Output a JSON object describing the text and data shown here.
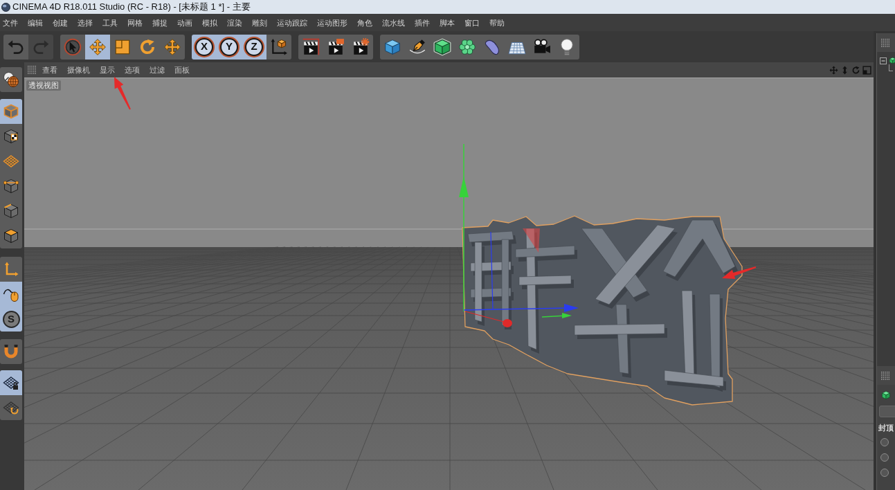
{
  "window": {
    "title": "CINEMA 4D R18.011 Studio (RC - R18) - [未标题 1 *] - 主要"
  },
  "menu": [
    "文件",
    "编辑",
    "创建",
    "选择",
    "工具",
    "网格",
    "捕捉",
    "动画",
    "模拟",
    "渲染",
    "雕刻",
    "运动跟踪",
    "运动图形",
    "角色",
    "流水线",
    "插件",
    "脚本",
    "窗口",
    "帮助"
  ],
  "toolbar": [
    {
      "items": [
        {
          "kind": "undo",
          "selected": false,
          "disabled": false
        },
        {
          "kind": "redo",
          "selected": false,
          "disabled": true
        }
      ]
    },
    {
      "items": [
        {
          "kind": "select",
          "selected": false,
          "disabled": false
        },
        {
          "kind": "move",
          "selected": true,
          "disabled": false
        },
        {
          "kind": "scale",
          "selected": false,
          "disabled": false
        },
        {
          "kind": "rotate",
          "selected": false,
          "disabled": false
        },
        {
          "kind": "transform",
          "selected": false,
          "disabled": false
        }
      ]
    },
    {
      "items": [
        {
          "kind": "axis-lock",
          "label": "X",
          "selected": true,
          "disabled": false
        },
        {
          "kind": "axis-lock",
          "label": "Y",
          "selected": true,
          "disabled": false
        },
        {
          "kind": "axis-lock",
          "label": "Z",
          "selected": true,
          "disabled": false
        },
        {
          "kind": "coordinates",
          "selected": false,
          "disabled": false
        }
      ]
    },
    {
      "items": [
        {
          "kind": "render-view",
          "selected": false,
          "disabled": false
        },
        {
          "kind": "render-picture",
          "selected": false,
          "disabled": false
        },
        {
          "kind": "render-settings",
          "selected": false,
          "disabled": false
        }
      ]
    },
    {
      "items": [
        {
          "kind": "cube",
          "selected": false,
          "disabled": false
        },
        {
          "kind": "pen",
          "selected": false,
          "disabled": false
        },
        {
          "kind": "subdivision",
          "selected": false,
          "disabled": false
        },
        {
          "kind": "cloner",
          "selected": false,
          "disabled": false
        },
        {
          "kind": "deformer",
          "selected": false,
          "disabled": false
        },
        {
          "kind": "floor",
          "selected": false,
          "disabled": false
        },
        {
          "kind": "camera",
          "selected": false,
          "disabled": false
        },
        {
          "kind": "light",
          "selected": false,
          "disabled": false
        }
      ]
    }
  ],
  "mode_toolbar": [
    {
      "items": [
        {
          "kind": "make-editable",
          "selected": false
        }
      ]
    },
    {
      "items": [
        {
          "kind": "model",
          "selected": true
        },
        {
          "kind": "texture",
          "selected": false
        },
        {
          "kind": "workplane",
          "selected": false
        },
        {
          "kind": "points",
          "selected": false
        },
        {
          "kind": "edges",
          "selected": false
        },
        {
          "kind": "polygons",
          "selected": false
        }
      ]
    },
    {
      "items": [
        {
          "kind": "axis",
          "selected": false
        },
        {
          "kind": "tweak",
          "selected": true
        },
        {
          "kind": "solo",
          "label": "S",
          "selected": true
        }
      ]
    },
    {
      "items": [
        {
          "kind": "snap",
          "selected": false
        }
      ]
    },
    {
      "items": [
        {
          "kind": "lock-workplane",
          "selected": true
        },
        {
          "kind": "planar-workplane",
          "selected": false
        }
      ]
    }
  ],
  "viewport": {
    "menu": [
      "查看",
      "摄像机",
      "显示",
      "选项",
      "过滤",
      "面板"
    ],
    "label": "透视视图"
  },
  "attributes": {
    "section": "封顶",
    "options": [
      {
        "selected": false
      },
      {
        "selected": false
      },
      {
        "selected": false
      }
    ]
  }
}
